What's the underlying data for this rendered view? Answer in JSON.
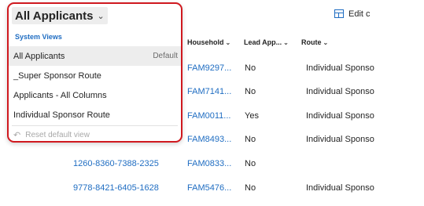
{
  "toolbar": {
    "edit_label": "Edit c"
  },
  "columns": [
    {
      "label": "Household"
    },
    {
      "label": "Lead App..."
    },
    {
      "label": "Route"
    }
  ],
  "rows": [
    {
      "id": "",
      "household": "FAM9297...",
      "lead": "No",
      "route": "Individual Sponso"
    },
    {
      "id": "",
      "household": "FAM7141...",
      "lead": "No",
      "route": "Individual Sponso"
    },
    {
      "id": "",
      "household": "FAM0011...",
      "lead": "Yes",
      "route": "Individual Sponso"
    },
    {
      "id": "",
      "household": "FAM8493...",
      "lead": "No",
      "route": "Individual Sponso"
    },
    {
      "id": "1260-8360-7388-2325",
      "household": "FAM0833...",
      "lead": "No",
      "route": ""
    },
    {
      "id": "9778-8421-6405-1628",
      "household": "FAM5476...",
      "lead": "No",
      "route": "Individual Sponso"
    }
  ],
  "view_selector": {
    "title": "All Applicants",
    "section_label": "System Views",
    "options": [
      {
        "label": "All Applicants",
        "badge": "Default",
        "selected": true
      },
      {
        "label": "_Super Sponsor Route",
        "badge": ""
      },
      {
        "label": "Applicants - All Columns",
        "badge": ""
      },
      {
        "label": "Individual Sponsor Route",
        "badge": ""
      }
    ],
    "reset_label": "Reset default view"
  },
  "icons": {
    "chevron": "chevron-down-icon",
    "edit": "edit-columns-icon",
    "reset": "reset-icon"
  },
  "colors": {
    "link": "#1f6dc2",
    "highlight_border": "#d0191f",
    "selected_bg": "#ededed"
  }
}
